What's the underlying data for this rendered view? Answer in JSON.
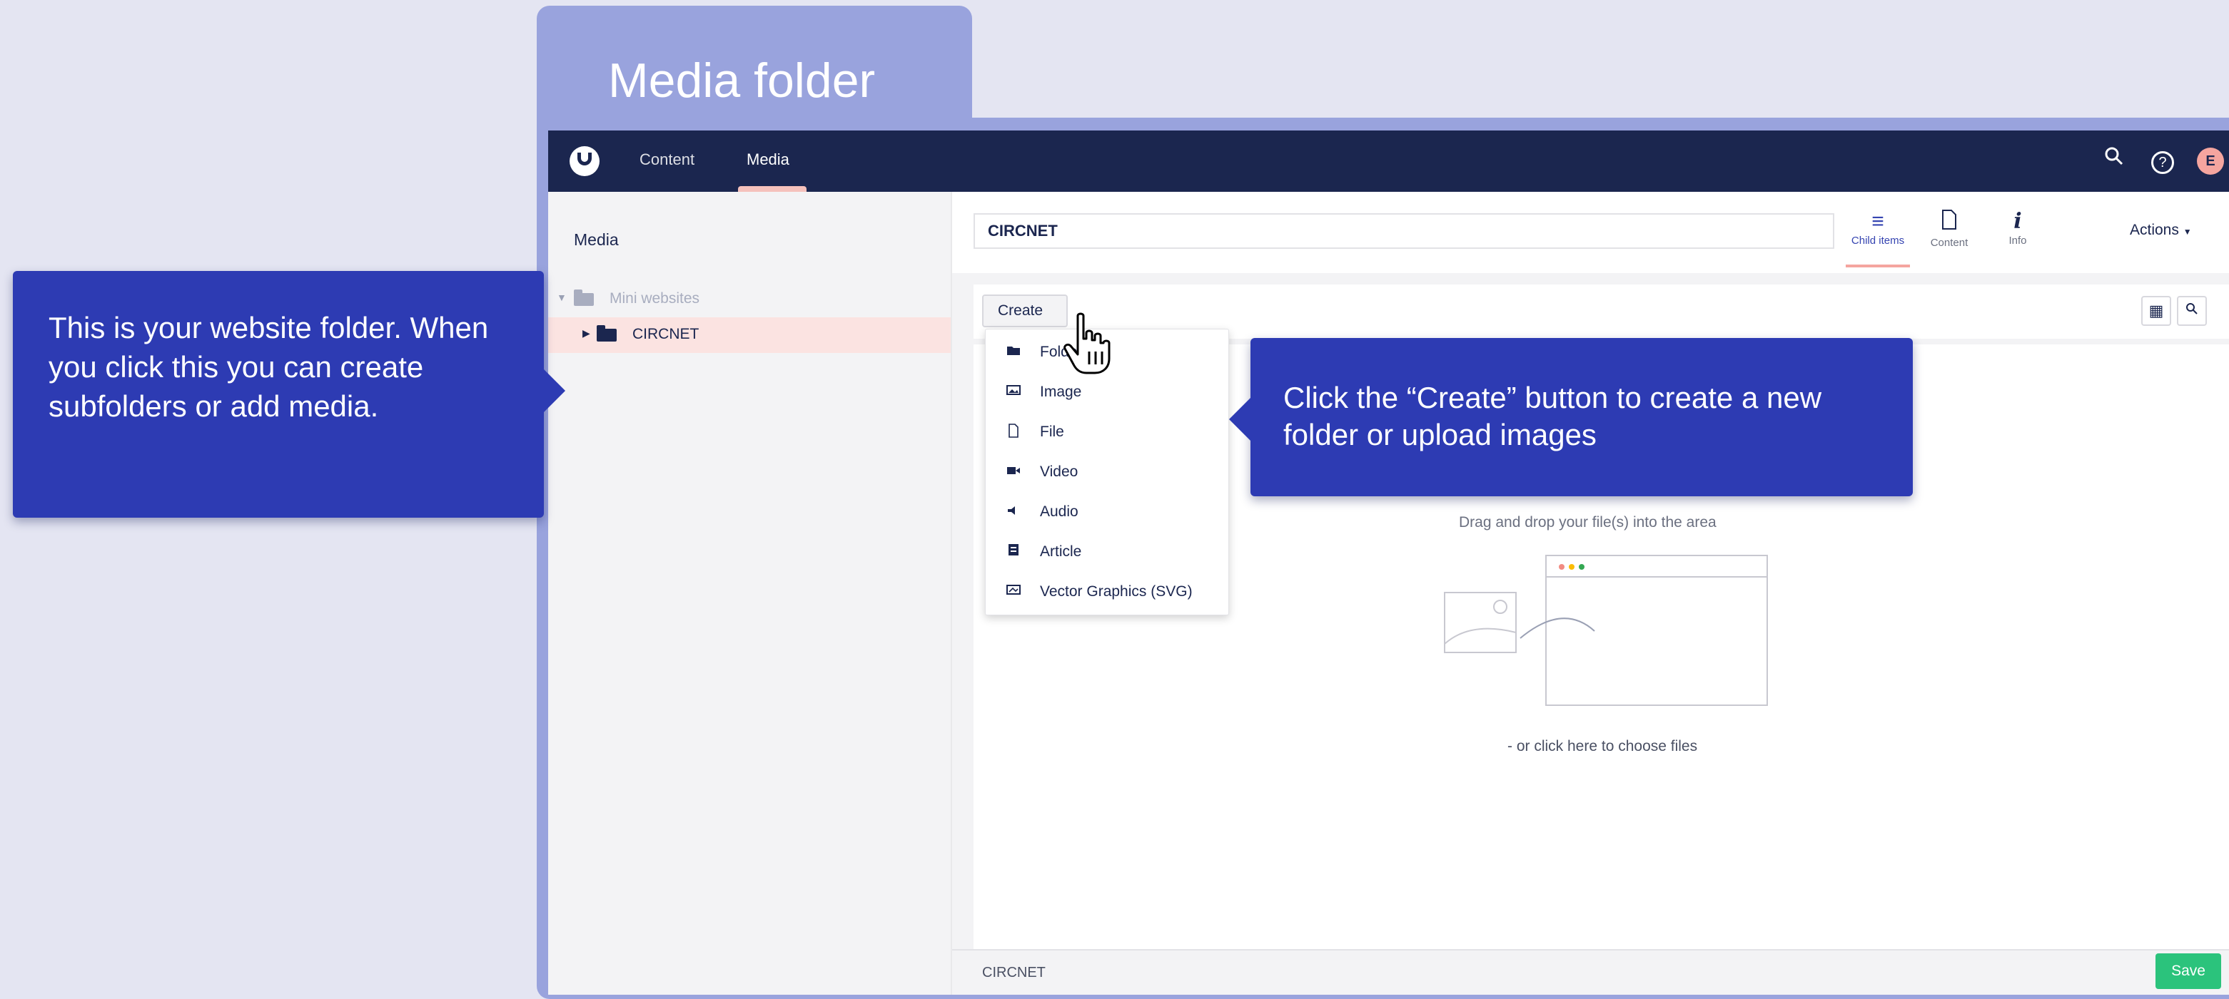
{
  "slide": {
    "heading": "Media folder",
    "callout_left": "This is your website folder. When you click this you can create subfolders or add media.",
    "callout_right": "Click the “Create” button to create a new folder or upload images"
  },
  "topnav": {
    "items": [
      {
        "label": "Content"
      },
      {
        "label": "Media"
      }
    ],
    "active": "Media",
    "avatar_initial": "E"
  },
  "sidebar": {
    "title": "Media",
    "tree": [
      {
        "label": "Mini websites"
      },
      {
        "label": "CIRCNET",
        "selected": true
      }
    ]
  },
  "editor": {
    "name_value": "CIRCNET",
    "tabs": [
      {
        "label": "Child items",
        "icon": "list-icon",
        "active": true
      },
      {
        "label": "Content",
        "icon": "document-icon"
      },
      {
        "label": "Info",
        "icon": "info-icon"
      }
    ],
    "actions_label": "Actions",
    "create_label": "Create",
    "dropzone_text": "Drag and drop your file(s) into the area",
    "choose_files_text": "- or click here to choose files",
    "footer_breadcrumb": "CIRCNET",
    "save_label": "Save"
  },
  "create_menu": [
    {
      "label": "Folder",
      "icon": "folder-icon"
    },
    {
      "label": "Image",
      "icon": "image-icon"
    },
    {
      "label": "File",
      "icon": "file-icon"
    },
    {
      "label": "Video",
      "icon": "video-icon"
    },
    {
      "label": "Audio",
      "icon": "audio-icon"
    },
    {
      "label": "Article",
      "icon": "article-icon"
    },
    {
      "label": "Vector Graphics (SVG)",
      "icon": "svg-icon"
    }
  ],
  "colors": {
    "callout_bg": "#2d3bb3",
    "topbar_bg": "#1b264f",
    "frame": "#99a3dd",
    "save_green": "#2bc37c",
    "selection_pink": "#fbe3e1"
  }
}
